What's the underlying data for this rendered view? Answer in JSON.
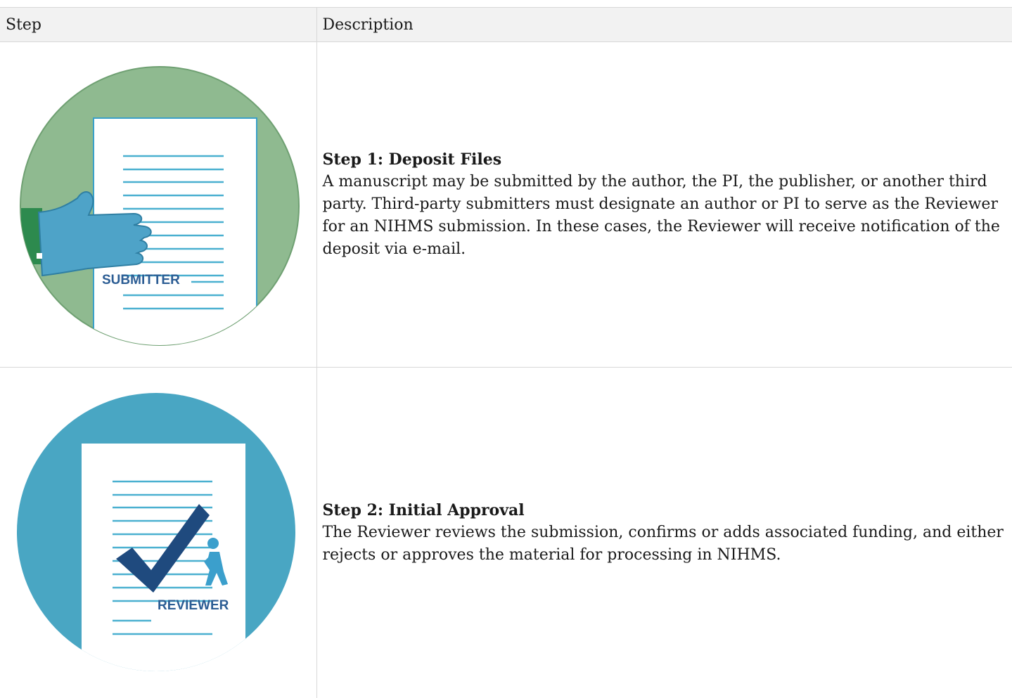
{
  "table": {
    "headers": {
      "step": "Step",
      "description": "Description"
    },
    "rows": [
      {
        "image_label": "SUBMITTER",
        "title": "Step 1: Deposit Files",
        "text": "A manuscript may be submitted by the author, the PI, the publisher, or another third party. Third-party submitters must designate an author or PI to serve as the Reviewer for an NIHMS submission. In these cases, the Reviewer will receive notification of the deposit via e-mail."
      },
      {
        "image_label": "REVIEWER",
        "title": "Step 2: Initial Approval",
        "text": "The Reviewer reviews the submission, confirms or adds associated funding, and either rejects or approves the material for processing in NIHMS."
      }
    ]
  },
  "colors": {
    "submitter_circle": "#8fba90",
    "reviewer_circle": "#49a6c3",
    "hand": "#4ea3c8",
    "sleeve": "#2d8a4e",
    "checkmark": "#1f4a7e",
    "figure": "#3b9fcc",
    "lines": "#4ab0d0",
    "label_text": "#2c5d94"
  },
  "icons": [
    "submitter-illustration",
    "reviewer-illustration"
  ]
}
